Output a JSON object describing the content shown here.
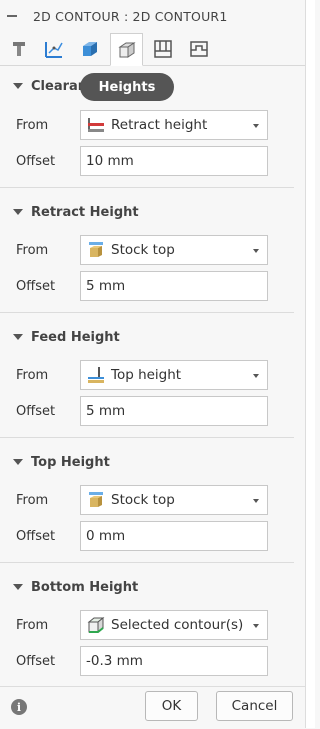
{
  "dialog": {
    "title": "2D CONTOUR : 2D CONTOUR1"
  },
  "tabs": [
    {
      "icon": "tool-icon"
    },
    {
      "icon": "geometry-icon"
    },
    {
      "icon": "stock-box-icon"
    },
    {
      "icon": "heights-icon",
      "active": true
    },
    {
      "icon": "passes-icon"
    },
    {
      "icon": "linking-icon"
    }
  ],
  "tooltip": {
    "text": "Heights"
  },
  "sections": {
    "clearance": {
      "title": "Clearance Height",
      "from_label": "From",
      "from_value": "Retract height",
      "offset_label": "Offset",
      "offset_value": "10 mm"
    },
    "retract": {
      "title": "Retract Height",
      "from_label": "From",
      "from_value": "Stock top",
      "offset_label": "Offset",
      "offset_value": "5 mm"
    },
    "feed": {
      "title": "Feed Height",
      "from_label": "From",
      "from_value": "Top height",
      "offset_label": "Offset",
      "offset_value": "5 mm"
    },
    "top": {
      "title": "Top Height",
      "from_label": "From",
      "from_value": "Stock top",
      "offset_label": "Offset",
      "offset_value": "0 mm"
    },
    "bottom": {
      "title": "Bottom Height",
      "from_label": "From",
      "from_value": "Selected contour(s)",
      "offset_label": "Offset",
      "offset_value": "-0.3 mm"
    }
  },
  "footer": {
    "ok_label": "OK",
    "cancel_label": "Cancel"
  }
}
